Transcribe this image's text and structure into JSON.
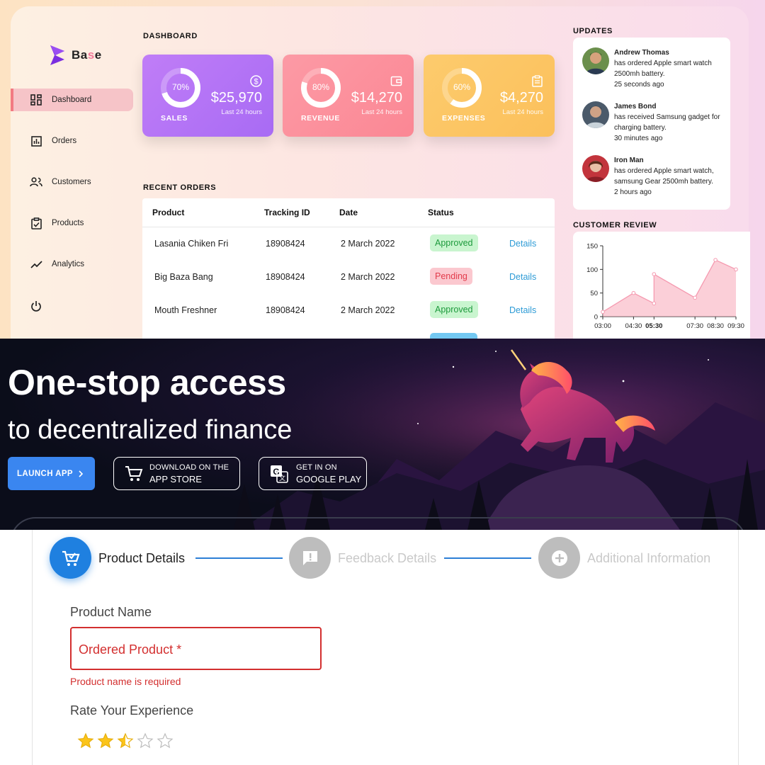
{
  "dashboard": {
    "logo": {
      "prefix": "Ba",
      "accent": "s",
      "suffix": "e"
    },
    "nav": [
      "Dashboard",
      "Orders",
      "Customers",
      "Products",
      "Analytics"
    ],
    "active_nav": "Dashboard",
    "title": "DASHBOARD",
    "stats": [
      {
        "label": "SALES",
        "percent": "70%",
        "progress": 0.7,
        "amount": "$25,970",
        "sub": "Last 24 hours",
        "icon": "dollar-icon",
        "color": "#b46cf6"
      },
      {
        "label": "REVENUE",
        "percent": "80%",
        "progress": 0.8,
        "amount": "$14,270",
        "sub": "Last 24 hours",
        "icon": "wallet-icon",
        "color": "#fc8e9a"
      },
      {
        "label": "EXPENSES",
        "percent": "60%",
        "progress": 0.6,
        "amount": "$4,270",
        "sub": "Last 24 hours",
        "icon": "clipboard-icon",
        "color": "#fcc666"
      }
    ],
    "recent_orders_title": "RECENT ORDERS",
    "orders_headers": [
      "Product",
      "Tracking ID",
      "Date",
      "Status"
    ],
    "orders": [
      {
        "product": "Lasania Chiken Fri",
        "tracking": "18908424",
        "date": "2 March 2022",
        "status": "Approved",
        "action": "Details"
      },
      {
        "product": "Big Baza Bang",
        "tracking": "18908424",
        "date": "2 March 2022",
        "status": "Pending",
        "action": "Details"
      },
      {
        "product": "Mouth Freshner",
        "tracking": "18908424",
        "date": "2 March 2022",
        "status": "Approved",
        "action": "Details"
      }
    ],
    "updates_title": "UPDATES",
    "updates": [
      {
        "name": "Andrew Thomas",
        "text": "has ordered Apple smart watch 2500mh battery.",
        "time": "25 seconds ago"
      },
      {
        "name": "James Bond",
        "text": "has received Samsung gadget for charging battery.",
        "time": "30 minutes ago"
      },
      {
        "name": "Iron Man",
        "text": "has ordered Apple smart watch, samsung Gear 2500mh battery.",
        "time": "2 hours ago"
      }
    ],
    "review_title": "CUSTOMER REVIEW"
  },
  "chart_data": {
    "type": "area",
    "x_ticks": [
      "03:00",
      "04:30",
      "05:30",
      "07:30",
      "08:30",
      "09:30"
    ],
    "x": [
      3.0,
      4.5,
      5.5,
      7.5,
      8.5,
      9.5
    ],
    "points": [
      {
        "x": 3.0,
        "y": 10
      },
      {
        "x": 4.5,
        "y": 50
      },
      {
        "x": 5.5,
        "y": 28
      },
      {
        "x": 5.5,
        "y": 90
      },
      {
        "x": 7.5,
        "y": 40
      },
      {
        "x": 8.5,
        "y": 120
      },
      {
        "x": 9.5,
        "y": 100
      }
    ],
    "y_ticks": [
      0,
      50,
      100,
      150
    ],
    "ylim": [
      0,
      150
    ],
    "xlim": [
      3.0,
      9.5
    ],
    "color": "#f7a8b8"
  },
  "hero": {
    "headline": "One-stop access",
    "subline": "to decentralized finance",
    "launch": "LAUNCH APP",
    "appstore_line1": "DOWNLOAD ON THE",
    "appstore_line2": "APP STORE",
    "play_line1": "GET IN ON",
    "play_line2": "GOOGLE PLAY"
  },
  "form": {
    "steps": [
      {
        "label": "Product Details",
        "active": true,
        "icon": "cart-check-icon"
      },
      {
        "label": "Feedback Details",
        "active": false,
        "icon": "feedback-icon"
      },
      {
        "label": "Additional Information",
        "active": false,
        "icon": "plus-circle-icon"
      }
    ],
    "product_name_label": "Product Name",
    "product_name_placeholder": "Ordered Product *",
    "product_name_error": "Product name is required",
    "rate_label": "Rate Your Experience",
    "rating": 2.5,
    "rating_max": 5
  }
}
